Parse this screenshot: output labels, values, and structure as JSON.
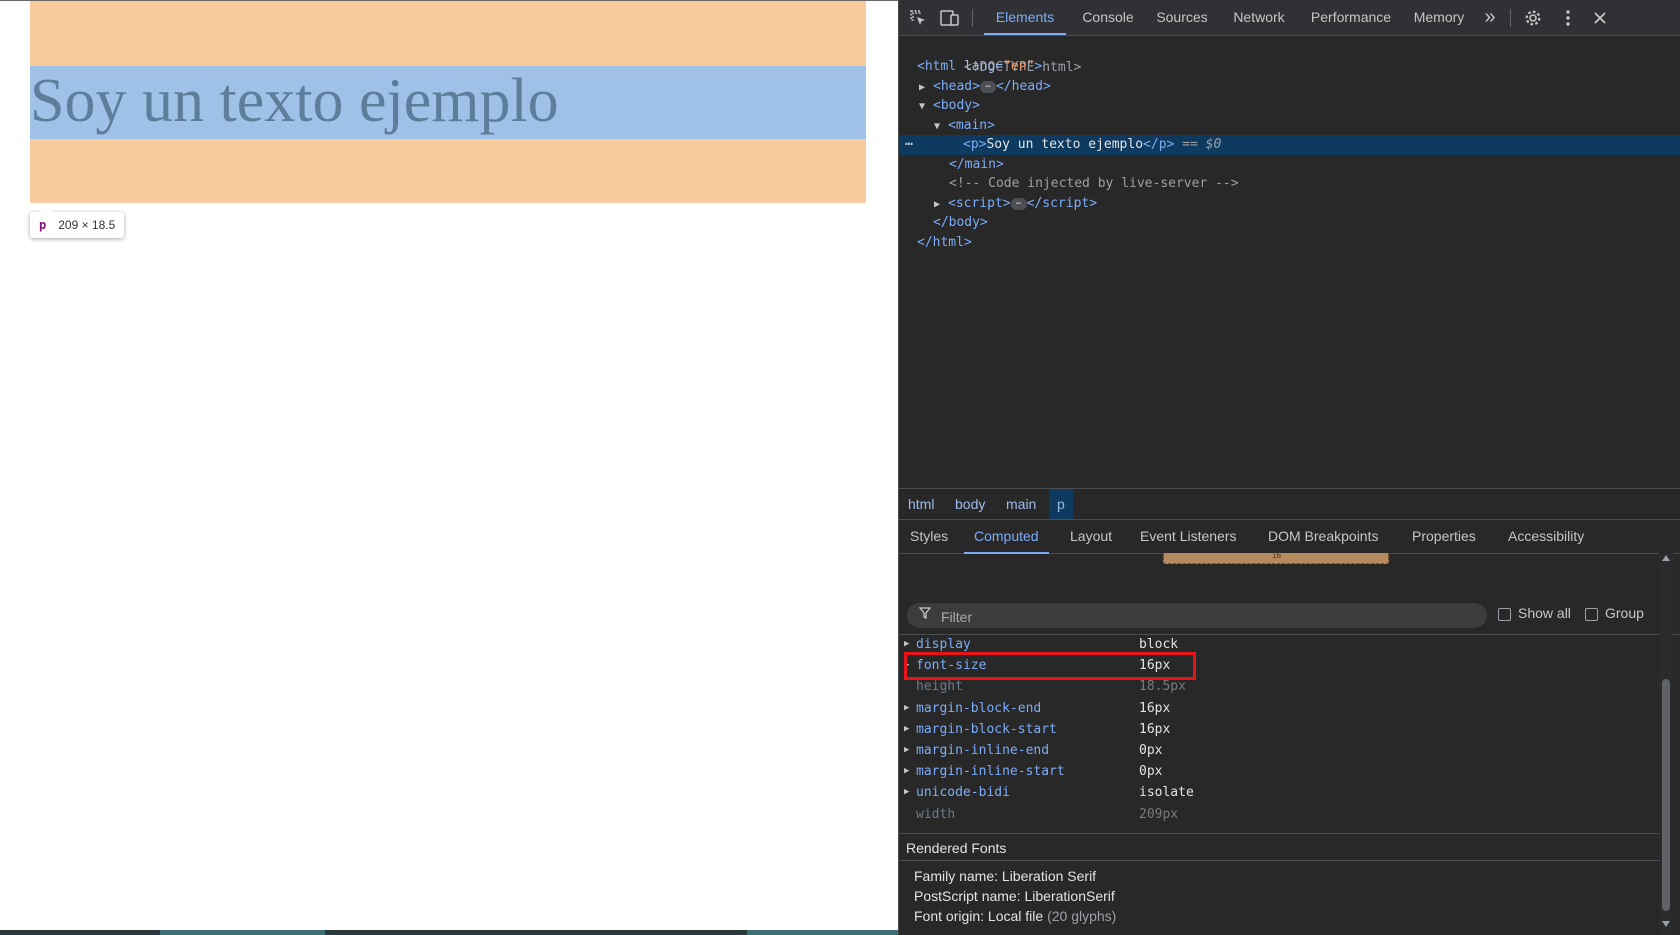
{
  "page": {
    "text": "Soy un texto ejemplo",
    "tooltip": {
      "tag": "p",
      "size": "209 × 18.5"
    }
  },
  "devtools": {
    "toolbar": {
      "tabs": [
        "Elements",
        "Console",
        "Sources",
        "Network",
        "Performance",
        "Memory"
      ],
      "active_tab": "Elements",
      "more": "»"
    },
    "dom": {
      "doctype": "<!DOCTYPE html>",
      "html_open": "html",
      "lang_attr": "lang",
      "lang_val": "\"en\"",
      "head": "head",
      "body": "body",
      "main": "main",
      "p": "p",
      "p_text": "Soy un texto ejemplo",
      "dollar": "== $0",
      "comment": "<!-- Code injected by live-server -->",
      "script": "script",
      "ellipsis": "⋯",
      "gutter": "⋯"
    },
    "breadcrumb": [
      "html",
      "body",
      "main",
      "p"
    ],
    "subtabs": [
      "Styles",
      "Computed",
      "Layout",
      "Event Listeners",
      "DOM Breakpoints",
      "Properties",
      "Accessibility"
    ],
    "active_subtab": "Computed",
    "box_value": "16",
    "filter": {
      "placeholder": "Filter",
      "show_all": "Show all",
      "group": "Group"
    },
    "computed": [
      {
        "name": "display",
        "value": "block",
        "inherited": false
      },
      {
        "name": "font-size",
        "value": "16px",
        "inherited": false
      },
      {
        "name": "height",
        "value": "18.5px",
        "inherited": true
      },
      {
        "name": "margin-block-end",
        "value": "16px",
        "inherited": false
      },
      {
        "name": "margin-block-start",
        "value": "16px",
        "inherited": false
      },
      {
        "name": "margin-inline-end",
        "value": "0px",
        "inherited": false
      },
      {
        "name": "margin-inline-start",
        "value": "0px",
        "inherited": false
      },
      {
        "name": "unicode-bidi",
        "value": "isolate",
        "inherited": false
      },
      {
        "name": "width",
        "value": "209px",
        "inherited": true
      }
    ],
    "rendered_fonts": {
      "header": "Rendered Fonts",
      "family": "Family name: Liberation Serif",
      "postscript": "PostScript name: LiberationSerif",
      "origin": "Font origin: Local file",
      "glyphs": "(20 glyphs)"
    },
    "colors": {
      "accent": "#7cacf8",
      "highlight": "#e8141a",
      "margin": "#f7cb9c",
      "content": "#9fc1e7"
    }
  }
}
